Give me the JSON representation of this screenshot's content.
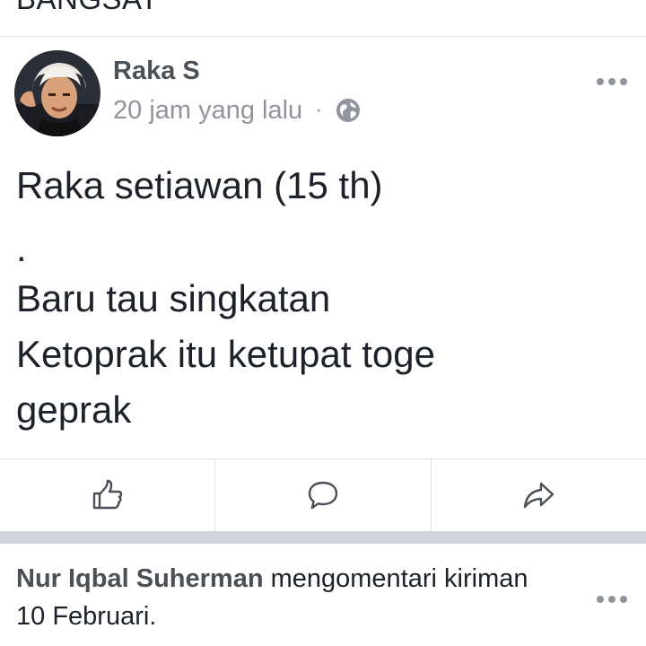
{
  "top_strip": {
    "text": "BANGSAT"
  },
  "post": {
    "author_name": "Raka S",
    "timestamp": "20 jam yang lalu",
    "meta_separator": "·",
    "privacy_icon": "globe-icon",
    "more_icon": "more-dots-icon",
    "body_lines": [
      "Raka setiawan (15 th)",
      ".",
      "Baru tau singkatan",
      "Ketoprak itu ketupat toge",
      "geprak"
    ]
  },
  "actions": [
    {
      "icon": "thumbs-up-icon"
    },
    {
      "icon": "comment-icon"
    },
    {
      "icon": "share-icon"
    }
  ],
  "activity": {
    "actor_name": "Nur Iqbal Suherman",
    "action_text": " mengomentari kiriman",
    "date_text": "10 Februari.",
    "more_icon": "more-dots-icon"
  },
  "colors": {
    "text_primary": "#1d2129",
    "text_secondary": "#90949c",
    "name": "#4b4f56",
    "divider": "#dddfe2",
    "separator": "#d1d5db"
  }
}
